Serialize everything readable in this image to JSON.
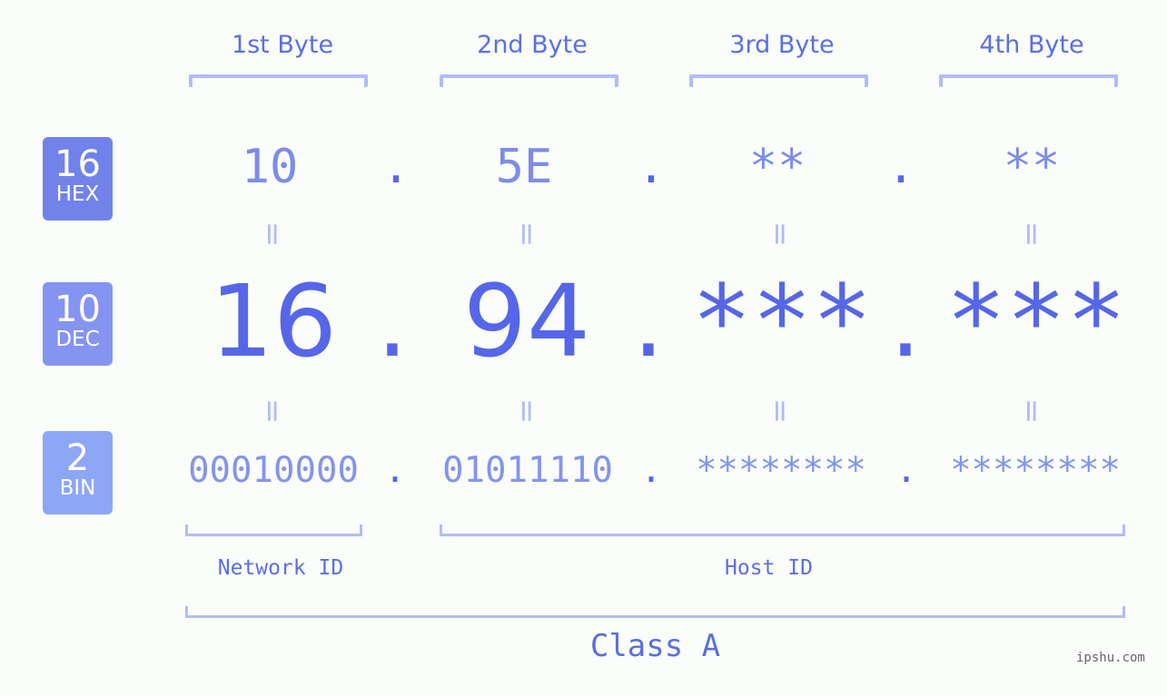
{
  "bytes": [
    {
      "label": "1st Byte",
      "hex": "10",
      "dec": "16",
      "bin": "00010000"
    },
    {
      "label": "2nd Byte",
      "hex": "5E",
      "dec": "94",
      "bin": "01011110"
    },
    {
      "label": "3rd Byte",
      "hex": "**",
      "dec": "***",
      "bin": "********"
    },
    {
      "label": "4th Byte",
      "hex": "**",
      "dec": "***",
      "bin": "********"
    }
  ],
  "badges": {
    "hex": {
      "num": "16",
      "unit": "HEX",
      "color": "#7183ea"
    },
    "dec": {
      "num": "10",
      "unit": "DEC",
      "color": "#8494f0"
    },
    "bin": {
      "num": "2",
      "unit": "BIN",
      "color": "#8ea6f6"
    }
  },
  "separator": ".",
  "equals": "=",
  "network_id_label": "Network ID",
  "host_id_label": "Host ID",
  "class_label": "Class A",
  "watermark": "ipshu.com"
}
